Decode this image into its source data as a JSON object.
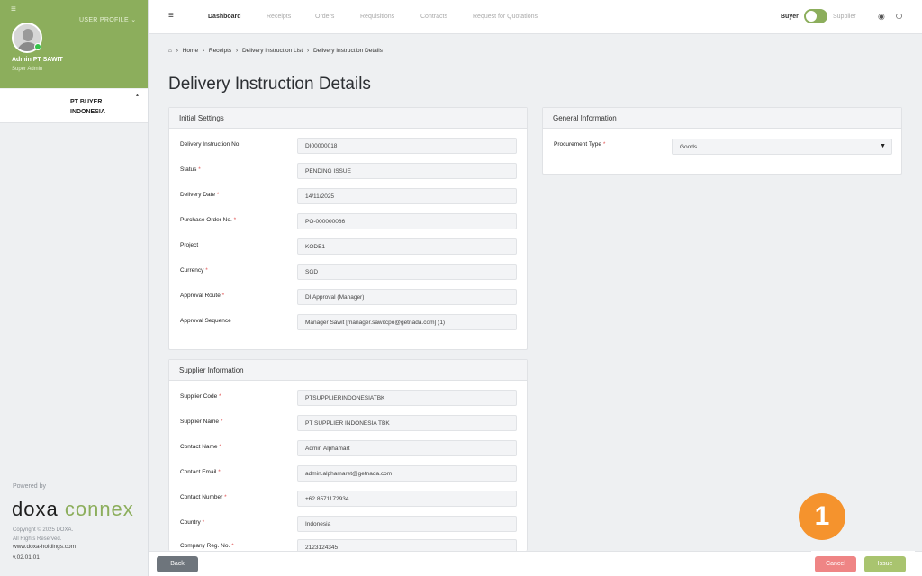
{
  "sidebar": {
    "menu_icon": "≡",
    "user_profile_label": "USER PROFILE ⌄",
    "user_name": "Admin PT SAWIT",
    "user_role": "Super Admin",
    "company_name": "PT BUYER INDONESIA",
    "powered_by": "Powered by",
    "logo_doxa": "doxa",
    "logo_connex": "connex",
    "copyright_line1": "Copyright © 2025 DOXA.",
    "copyright_line2": "All Rights Reserved.",
    "website": "www.doxa-holdings.com",
    "version": "v.02.01.01"
  },
  "topbar": {
    "menu_icon": "≡",
    "nav": [
      "Dashboard",
      "Receipts",
      "Orders",
      "Requisitions",
      "Contracts",
      "Request for Quotations"
    ],
    "active_nav": "Dashboard",
    "buyer_label": "Buyer",
    "supplier_label": "Supplier",
    "globe_icon": "globe-icon",
    "power_icon": "power-icon"
  },
  "breadcrumb": {
    "home_icon": "home-icon",
    "items": [
      "Home",
      "Receipts",
      "Delivery Instruction List",
      "Delivery Instruction Details"
    ]
  },
  "page_title": "Delivery Instruction Details",
  "initial_settings": {
    "title": "Initial Settings",
    "fields": [
      {
        "label": "Delivery Instruction No.",
        "required": "",
        "value": "DI00000018"
      },
      {
        "label": "Status",
        "required": "*",
        "value": "PENDING ISSUE"
      },
      {
        "label": "Delivery Date",
        "required": "*",
        "value": "14/11/2025"
      },
      {
        "label": "Purchase Order No.",
        "required": "*",
        "value": "PO-000000086"
      },
      {
        "label": "Project",
        "required": "",
        "value": "KODE1"
      },
      {
        "label": "Currency",
        "required": "*",
        "value": "SGD"
      },
      {
        "label": "Approval Route",
        "required": "*",
        "value": "DI Approval (Manager)"
      },
      {
        "label": "Approval Sequence",
        "required": "",
        "value": "Manager Sawit [manager.sawitcpo@getnada.com] (1)"
      }
    ]
  },
  "general_information": {
    "title": "General Information",
    "procurement_type_label": "Procurement Type",
    "required": "*",
    "procurement_type_value": "Goods"
  },
  "supplier_information": {
    "title": "Supplier Information",
    "fields": [
      {
        "label": "Supplier Code",
        "required": "*",
        "value": "PTSUPPLIERINDONESIATBK"
      },
      {
        "label": "Supplier Name",
        "required": "*",
        "value": "PT SUPPLIER INDONESIA TBK"
      },
      {
        "label": "Contact Name",
        "required": "*",
        "value": "Admin Alphamart"
      },
      {
        "label": "Contact Email",
        "required": "*",
        "value": "admin.alphamaret@getnada.com"
      },
      {
        "label": "Contact Number",
        "required": "*",
        "value": "+62 8571172934"
      },
      {
        "label": "Country",
        "required": "*",
        "value": "Indonesia"
      },
      {
        "label": "Company Reg. No.",
        "required": "*",
        "value": "2123124345"
      }
    ]
  },
  "footer": {
    "back_label": "Back",
    "cancel_label": "Cancel",
    "issue_label": "Issue"
  },
  "annotation": {
    "badge_number": "1"
  }
}
